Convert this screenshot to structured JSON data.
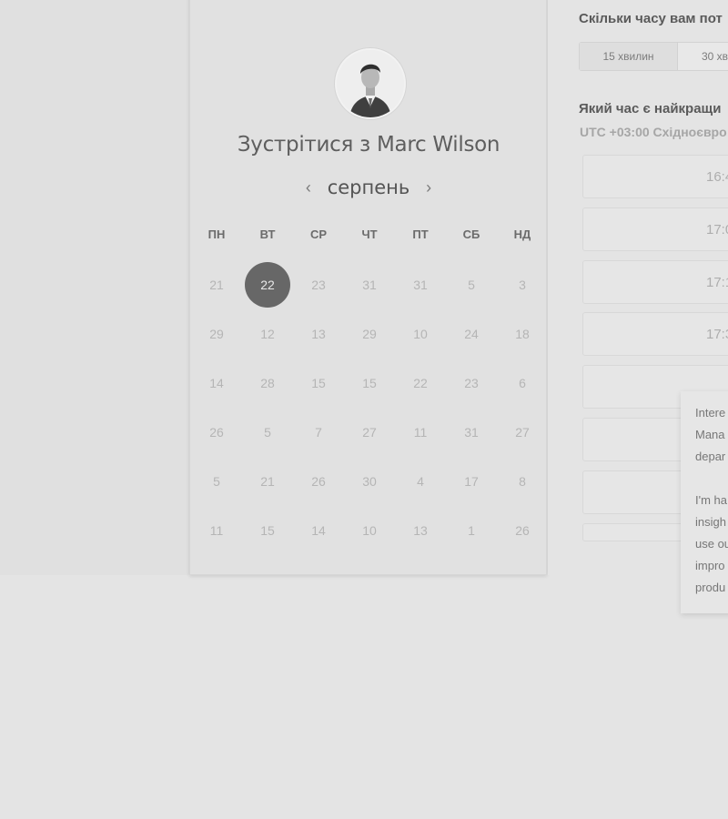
{
  "booking": {
    "title": "Зустрітися з Marc Wilson",
    "month": "серпень",
    "prev_icon": "chevron-left-icon",
    "next_icon": "chevron-right-icon",
    "avatar": "host-avatar"
  },
  "calendar": {
    "weekdays": [
      "ПН",
      "ВТ",
      "СР",
      "ЧТ",
      "ПТ",
      "СБ",
      "НД"
    ],
    "selected_day": "22",
    "days": [
      [
        "21",
        "22",
        "23",
        "31",
        "31",
        "5",
        "3"
      ],
      [
        "29",
        "12",
        "13",
        "29",
        "10",
        "24",
        "18"
      ],
      [
        "14",
        "28",
        "15",
        "15",
        "22",
        "23",
        "6"
      ],
      [
        "26",
        "5",
        "7",
        "27",
        "11",
        "31",
        "27"
      ],
      [
        "5",
        "21",
        "26",
        "30",
        "4",
        "17",
        "8"
      ],
      [
        "11",
        "15",
        "14",
        "10",
        "13",
        "1",
        "26"
      ]
    ]
  },
  "duration": {
    "question": "Скільки часу вам пот",
    "options": [
      "15 хвилин",
      "30 хв"
    ]
  },
  "time": {
    "question": "Який час є найкращи",
    "timezone": "UTC +03:00 Східноєвро",
    "slots": [
      "16:4",
      "17:0",
      "17:1",
      "17:3",
      "",
      "",
      "",
      ""
    ]
  },
  "message": {
    "lines_1": "Intere\nMana\ndepar",
    "lines_2": "I'm ha\ninsigh\nuse ou\nimpro\nprodu"
  },
  "colors": {
    "selected_day_bg": "#676767",
    "page_bg": "#e4e4e4"
  }
}
